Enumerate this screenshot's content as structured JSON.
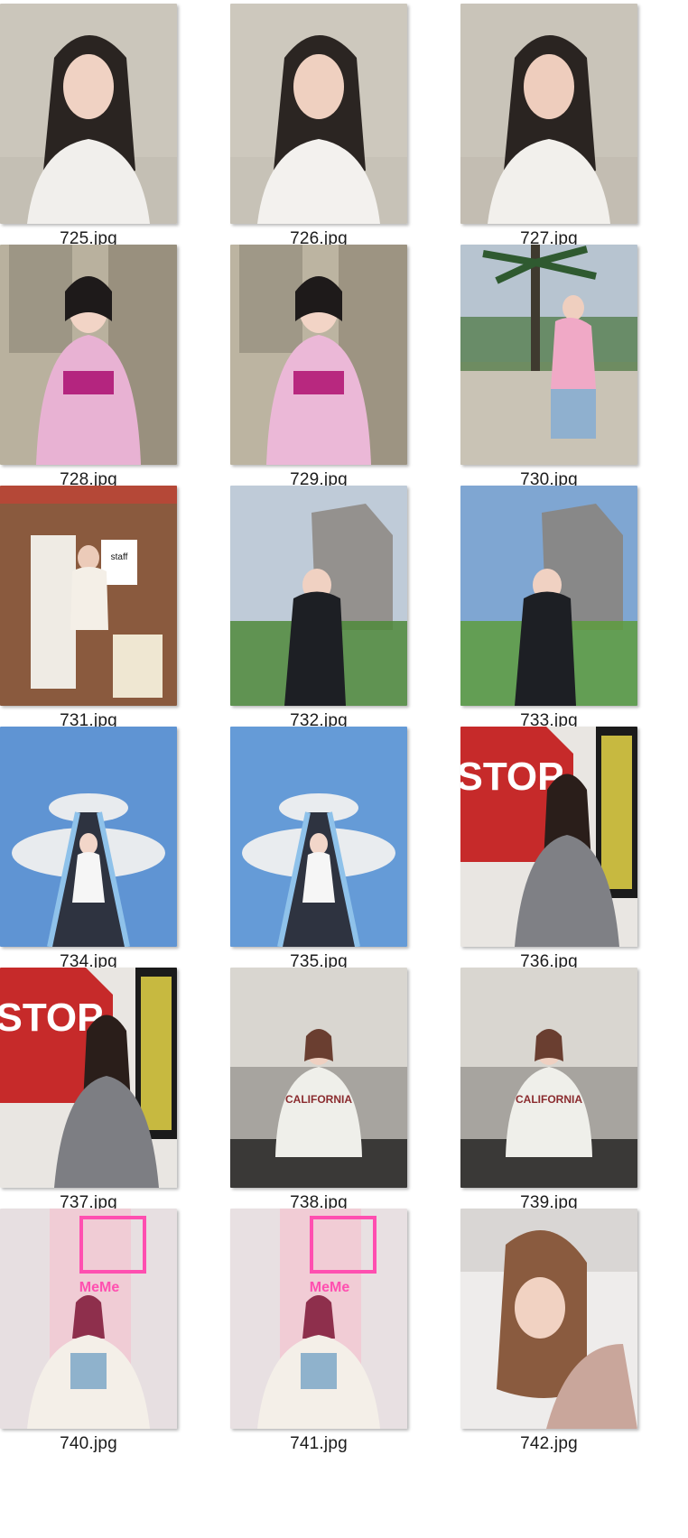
{
  "files": [
    {
      "name": "725.jpg",
      "scene": "portrait-indoor",
      "colors": {
        "bg": "#cbc6bb",
        "bg2": "#b7b2a8",
        "top": "#f1efec",
        "hair": "#2a2421",
        "skin": "#f0d2c3"
      }
    },
    {
      "name": "726.jpg",
      "scene": "portrait-indoor",
      "colors": {
        "bg": "#cdc8bd",
        "bg2": "#bcb6ab",
        "top": "#f3f1ee",
        "hair": "#2b2522",
        "skin": "#efd0c0"
      }
    },
    {
      "name": "727.jpg",
      "scene": "portrait-indoor",
      "colors": {
        "bg": "#c9c4b9",
        "bg2": "#b8b2a7",
        "top": "#f2f0ec",
        "hair": "#2a2421",
        "skin": "#eecdbd"
      }
    },
    {
      "name": "728.jpg",
      "scene": "kimono-shop",
      "colors": {
        "bg": "#b9b19e",
        "bg2": "#7f7565",
        "top": "#e8b2d3",
        "hair": "#1e1a1a",
        "skin": "#f2d4c6",
        "accent": "#b4257f"
      }
    },
    {
      "name": "729.jpg",
      "scene": "kimono-shop",
      "colors": {
        "bg": "#bcb4a1",
        "bg2": "#847a6a",
        "top": "#ebb8d7",
        "hair": "#1e1a1a",
        "skin": "#f2d4c6",
        "accent": "#b8287f"
      }
    },
    {
      "name": "730.jpg",
      "scene": "palm-overlook",
      "colors": {
        "bg": "#b7c4d0",
        "bg2": "#4f7a45",
        "top": "#f0a9c6",
        "hair": "#5d3a2e",
        "skin": "#efcfbf",
        "accent": "#8fb0cf"
      }
    },
    {
      "name": "731.jpg",
      "scene": "wood-room",
      "colors": {
        "bg": "#8a5a3e",
        "bg2": "#5a3626",
        "top": "#f4efe7",
        "hair": "#1f1a18",
        "skin": "#eccbb9",
        "accent": "#d93a31"
      }
    },
    {
      "name": "732.jpg",
      "scene": "ruins-sky",
      "colors": {
        "bg": "#bfcbd8",
        "bg2": "#8f8b86",
        "top": "#1d1f24",
        "hair": "#3b241f",
        "skin": "#f0d1c2",
        "accent": "#4f8a3b"
      }
    },
    {
      "name": "733.jpg",
      "scene": "ruins-sky",
      "colors": {
        "bg": "#7fa6d2",
        "bg2": "#8a8580",
        "top": "#1d1f24",
        "hair": "#3b241f",
        "skin": "#f0d1c2",
        "accent": "#5e9c3e"
      }
    },
    {
      "name": "734.jpg",
      "scene": "stairs-sky",
      "colors": {
        "bg": "#5f94d3",
        "bg2": "#e8ebee",
        "top": "#f6f6f6",
        "hair": "#4a3028",
        "skin": "#f2d6c9",
        "accent": "#8fc2ea"
      }
    },
    {
      "name": "735.jpg",
      "scene": "stairs-sky",
      "colors": {
        "bg": "#659bd7",
        "bg2": "#e9ecef",
        "top": "#f6f6f6",
        "hair": "#4a3028",
        "skin": "#f2d6c9",
        "accent": "#8fc2ea"
      }
    },
    {
      "name": "736.jpg",
      "scene": "stop-sign",
      "colors": {
        "bg": "#c62a2a",
        "bg2": "#1b1b1b",
        "top": "#7f8085",
        "hair": "#2a1e1a",
        "skin": "#f0d0c1",
        "accent": "#f3e14a"
      }
    },
    {
      "name": "737.jpg",
      "scene": "stop-sign",
      "colors": {
        "bg": "#c62a2a",
        "bg2": "#1b1b1b",
        "top": "#7d7e83",
        "hair": "#2a1e1a",
        "skin": "#f0d0c1",
        "accent": "#f3e14a"
      }
    },
    {
      "name": "738.jpg",
      "scene": "concrete-sweatshirt",
      "colors": {
        "bg": "#d9d6d0",
        "bg2": "#7e7b77",
        "top": "#efefea",
        "hair": "#6a3e30",
        "skin": "#efd0c1",
        "accent": "#8a2b2e"
      }
    },
    {
      "name": "739.jpg",
      "scene": "concrete-sweatshirt",
      "colors": {
        "bg": "#d9d6d0",
        "bg2": "#7e7b77",
        "top": "#efefea",
        "hair": "#6a3e30",
        "skin": "#efd0c1",
        "accent": "#8a2b2e"
      }
    },
    {
      "name": "740.jpg",
      "scene": "neon-store",
      "colors": {
        "bg": "#e7dfe1",
        "bg2": "#f2c7d2",
        "top": "#f4efe8",
        "hair": "#8e2f4c",
        "skin": "#f3d4c8",
        "accent": "#ff4fb0"
      }
    },
    {
      "name": "741.jpg",
      "scene": "neon-store",
      "colors": {
        "bg": "#e8e0e2",
        "bg2": "#f2c7d2",
        "top": "#f4efe8",
        "hair": "#8e2f4c",
        "skin": "#f3d4c8",
        "accent": "#ff4fb0"
      }
    },
    {
      "name": "742.jpg",
      "scene": "bed-selfie",
      "colors": {
        "bg": "#eeeceb",
        "bg2": "#d9d6d4",
        "top": "#c9a69b",
        "hair": "#8a5b3f",
        "skin": "#f1d2c2",
        "accent": "#f6f6f6"
      }
    }
  ]
}
